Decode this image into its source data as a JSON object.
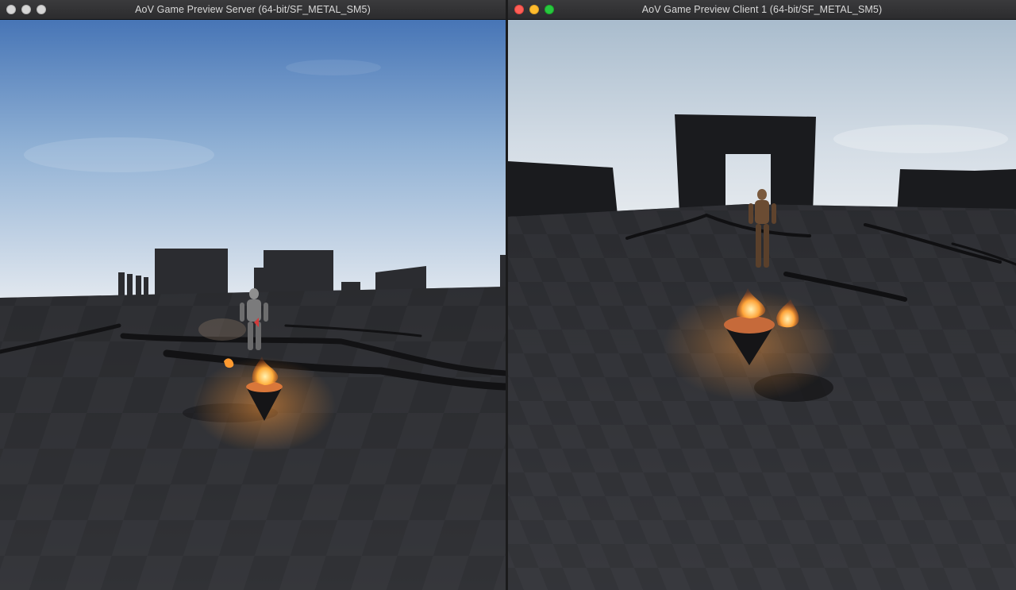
{
  "windows": {
    "server": {
      "title": "AoV Game Preview Server (64-bit/SF_METAL_SM5)",
      "controls": [
        "close",
        "minimize",
        "zoom"
      ],
      "controls_state": "inactive"
    },
    "client": {
      "title": "AoV Game Preview Client 1 (64-bit/SF_METAL_SM5)",
      "controls": [
        "close",
        "minimize",
        "zoom"
      ],
      "controls_state": "active"
    }
  },
  "colors": {
    "close": "#fe5f57",
    "minimize": "#febc2e",
    "zoom": "#28c840",
    "inactive": "#d6d6d6",
    "sky_top": "#4a78b8",
    "sky_bottom": "#dfe6ee",
    "ground": "#2f2f33",
    "fire": "#ffa23a"
  },
  "icons": {
    "close": "close-icon",
    "minimize": "minimize-icon",
    "zoom": "zoom-icon"
  }
}
